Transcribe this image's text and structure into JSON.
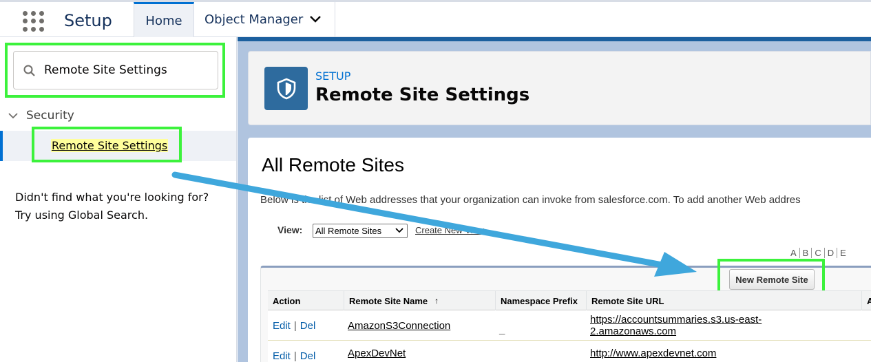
{
  "nav": {
    "app_name": "Setup",
    "tabs": [
      {
        "label": "Home"
      },
      {
        "label": "Object Manager"
      }
    ]
  },
  "sidebar": {
    "search_value": "Remote Site Settings",
    "section": "Security",
    "item": "Remote Site Settings",
    "help_line1": "Didn't find what you're looking for?",
    "help_line2": "Try using Global Search."
  },
  "header": {
    "eyebrow": "SETUP",
    "title": "Remote Site Settings"
  },
  "content": {
    "heading": "All Remote Sites",
    "description": "Below is the list of Web addresses that your organization can invoke from salesforce.com. To add another Web addres",
    "view_label": "View:",
    "view_selected": "All Remote Sites",
    "create_view": "Create New View",
    "alpha": [
      "A",
      "B",
      "C",
      "D",
      "E"
    ],
    "new_button": "New Remote Site"
  },
  "table": {
    "columns": [
      "Action",
      "Remote Site Name",
      "Namespace Prefix",
      "Remote Site URL",
      "A"
    ],
    "sort_indicator": "↑",
    "rows": [
      {
        "edit": "Edit",
        "sep": "|",
        "del": "Del",
        "name": "AmazonS3Connection",
        "prefix": "_",
        "url_line1": "https://accountsummaries.s3.us-east-",
        "url_line2": "2.amazonaws.com"
      },
      {
        "edit": "Edit",
        "sep": "|",
        "del": "Del",
        "name": "ApexDevNet",
        "prefix": "_",
        "url_line1": "http://www.apexdevnet.com",
        "url_line2": ""
      }
    ]
  },
  "colors": {
    "highlight": "#3cf23c",
    "arrow": "#3fa7dc",
    "brand": "#0070d2"
  }
}
